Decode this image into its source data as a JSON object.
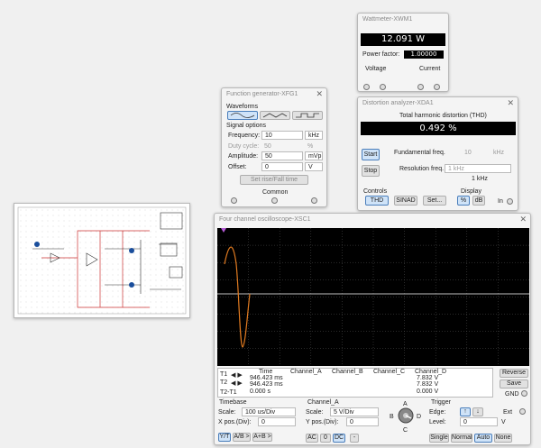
{
  "wattmeter": {
    "title": "Wattmeter-XWM1",
    "reading": "12.091 W",
    "pf_label": "Power factor:",
    "pf_value": "1.00000",
    "voltage_label": "Voltage",
    "current_label": "Current"
  },
  "fg": {
    "title": "Function generator-XFG1",
    "waveforms_label": "Waveforms",
    "signal_options_label": "Signal options",
    "frequency_label": "Frequency:",
    "frequency_value": "10",
    "frequency_unit": "kHz",
    "duty_label": "Duty cycle:",
    "duty_value": "50",
    "duty_unit": "%",
    "amplitude_label": "Amplitude:",
    "amplitude_value": "50",
    "amplitude_unit": "mVp",
    "offset_label": "Offset:",
    "offset_value": "0",
    "offset_unit": "V",
    "rise_fall_label": "Set rise/Fall time",
    "common_label": "Common"
  },
  "da": {
    "title": "Distortion analyzer-XDA1",
    "thd_title": "Total harmonic distortion (THD)",
    "thd_value": "0.492 %",
    "start_label": "Start",
    "stop_label": "Stop",
    "fund_label": "Fundamental freq.",
    "fund_value": "10",
    "fund_unit": "kHz",
    "res_label": "Resolution freq.",
    "res_value": "1 kHz",
    "res_sub": "1 kHz",
    "controls_label": "Controls",
    "thd_btn": "THD",
    "sinad_btn": "SINAD",
    "set_btn": "Set...",
    "display_label": "Display",
    "pct_btn": "%",
    "db_btn": "dB",
    "in_label": "In"
  },
  "osc": {
    "title": "Four channel oscilloscope-XSC1",
    "readout": {
      "headers": [
        "Time",
        "Channel_A",
        "Channel_B",
        "Channel_C",
        "Channel_D"
      ],
      "rows": [
        {
          "name": "T1",
          "time": "946.423 ms",
          "d": "7.832 V"
        },
        {
          "name": "T2",
          "time": "946.423 ms",
          "d": "7.832 V"
        },
        {
          "name": "T2-T1",
          "time": "0.000 s",
          "d": "0.000 V"
        }
      ]
    },
    "reverse_label": "Reverse",
    "save_label": "Save",
    "gnd_label": "GND",
    "timebase": {
      "label": "Timebase",
      "scale_label": "Scale:",
      "scale_value": "100 us/Div",
      "xpos_label": "X pos.(Div):",
      "xpos_value": "0",
      "btns": [
        "Y/T",
        "A/B >",
        "A+B >"
      ]
    },
    "channel": {
      "label": "Channel_A",
      "scale_label": "Scale:",
      "scale_value": "5 V/Div",
      "ypos_label": "Y pos.(Div):",
      "ypos_value": "0",
      "btns": [
        "AC",
        "0",
        "DC",
        "-"
      ],
      "knob": [
        "A",
        "B",
        "C",
        "D"
      ]
    },
    "trigger": {
      "label": "Trigger",
      "edge_label": "Edge:",
      "level_label": "Level:",
      "level_value": "0",
      "level_unit": "V",
      "ext_label": "Ext",
      "btns": [
        "Single",
        "Normal",
        "Auto",
        "None"
      ]
    }
  },
  "colors": {
    "trace": "#e07a20",
    "screen": "#000000"
  }
}
